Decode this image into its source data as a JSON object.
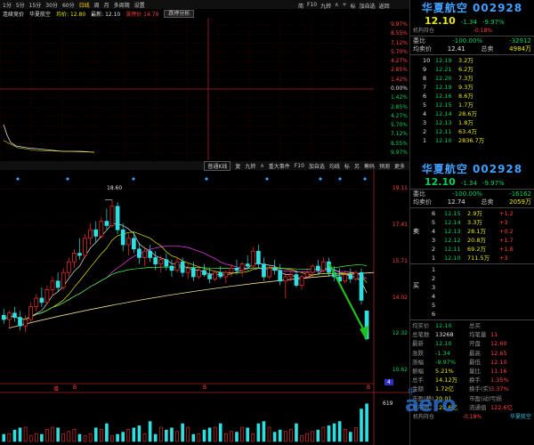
{
  "toolbar": {
    "periods": [
      "1分",
      "5分",
      "15分",
      "30分",
      "60分",
      "日线",
      "周",
      "月",
      "多周期",
      "设置"
    ],
    "active_period": "日线",
    "tools": [
      "简",
      "F10",
      "九转",
      "∧",
      "+",
      "标",
      "加自选",
      "返回"
    ]
  },
  "intraday": {
    "label": "连续竞价",
    "stock_label": "华夏航空",
    "price_label": "均价: 12.80",
    "volume_label": "最新: 12.10",
    "extra_label": "涨停价 14.79",
    "dropdown": "跌停分析",
    "scale_right": [
      "9.97%",
      "8.55%",
      "7.12%",
      "5.70%",
      "4.27%",
      "2.85%",
      "1.42%",
      "0.00%",
      "1.42%",
      "2.85%",
      "4.27%",
      "5.70%",
      "7.12%",
      "8.55%",
      "9.97%"
    ]
  },
  "kline": {
    "toolbar": [
      "普通K线",
      "复",
      "九转",
      "∧",
      "重大事件",
      "F10",
      "加自选",
      "均线",
      "标",
      "另",
      "筹码",
      "预测",
      "更多"
    ],
    "high_label": "18.60",
    "scale_right": [
      "19.11",
      "17.41",
      "15.71",
      "14.02",
      "12.32",
      "10.62"
    ],
    "low_scale": "4",
    "bottom_labels": [
      "增",
      "B",
      "B",
      "B"
    ],
    "volume_scale": [
      "619"
    ]
  },
  "quote_top": {
    "title": "华夏航空 002928",
    "price": "12.10",
    "change": "-1.34",
    "change_pct": "-9.97%",
    "bid_ratio_label": "委比",
    "bid_ratio": "-100.00%",
    "bid_diff": "-32912",
    "avg_label": "均卖价",
    "avg_price": "12.41",
    "total_label": "总卖",
    "total_sell": "4984万",
    "sell_rows": [
      {
        "lvl": "10",
        "price": "12.19",
        "vol": "3.2万"
      },
      {
        "lvl": "9",
        "price": "12.21",
        "vol": "6.2万"
      },
      {
        "lvl": "8",
        "price": "12.20",
        "vol": "7.3万"
      },
      {
        "lvl": "7",
        "price": "12.19",
        "vol": "9.3万"
      },
      {
        "lvl": "6",
        "price": "12.16",
        "vol": "8.6万"
      },
      {
        "lvl": "5",
        "price": "12.15",
        "vol": "1.7万"
      },
      {
        "lvl": "4",
        "price": "12.14",
        "vol": "28.6万"
      },
      {
        "lvl": "3",
        "price": "12.13",
        "vol": "1.8万"
      },
      {
        "lvl": "2",
        "price": "12.11",
        "vol": "63.4万"
      },
      {
        "lvl": "1",
        "price": "12.10",
        "vol": "2836.7万"
      }
    ]
  },
  "quote_main": {
    "title": "华夏航空 002928",
    "price": "12.10",
    "change": "-1.34",
    "change_pct": "-9.97%",
    "bid_ratio_label": "委比",
    "bid_ratio": "-100.00%",
    "bid_diff": "-16162",
    "avg_label": "均卖价",
    "avg_price": "12.74",
    "total_label": "总卖",
    "total_sell": "2059万",
    "sell_side_label": "卖",
    "buy_side_label": "买",
    "sell_rows": [
      {
        "lvl": "6",
        "price": "12.15",
        "vol": "2.9万",
        "tag": "+1.2"
      },
      {
        "lvl": "5",
        "price": "12.14",
        "vol": "3.3万",
        "tag": "+3"
      },
      {
        "lvl": "4",
        "price": "12.13",
        "vol": "28.1万",
        "tag": "+0.2"
      },
      {
        "lvl": "3",
        "price": "12.12",
        "vol": "20.8万",
        "tag": "+1.7"
      },
      {
        "lvl": "2",
        "price": "12.11",
        "vol": "69.2万",
        "tag": "+1.8"
      },
      {
        "lvl": "1",
        "price": "12.10",
        "vol": "711.5万",
        "tag": "+3"
      }
    ],
    "buy_rows": [
      {
        "lvl": "1"
      },
      {
        "lvl": "2"
      },
      {
        "lvl": "3"
      },
      {
        "lvl": "4"
      },
      {
        "lvl": "5"
      },
      {
        "lvl": "6"
      }
    ],
    "stats": [
      {
        "k1": "均买价",
        "v1": "12.10",
        "k2": "总买",
        "v2": ""
      },
      {
        "k1": "总笔数",
        "v1": "13268",
        "k2": "均笔量",
        "v2": "11"
      },
      {
        "k1": "最新",
        "v1": "12.10",
        "k2": "开盘",
        "v2": "12.60"
      },
      {
        "k1": "涨跌",
        "v1": "-1.34",
        "k2": "最高",
        "v2": "12.65"
      },
      {
        "k1": "涨幅",
        "v1": "-9.97%",
        "k2": "最低",
        "v2": "12.10"
      },
      {
        "k1": "振幅",
        "v1": "5.21%",
        "k2": "量比",
        "v2": "11.16"
      },
      {
        "k1": "总手",
        "v1": "14.12万",
        "k2": "换手",
        "v2": "1.35%"
      },
      {
        "k1": "金额",
        "v1": "1.72亿",
        "k2": "换手(实)",
        "v2": "3.37%"
      },
      {
        "k1": "市盈(静)",
        "v1": "20.01",
        "k2": "市盈(动)",
        "v2": "亏损"
      },
      {
        "k1": "总市值",
        "v1": "122.6亿",
        "k2": "流通值",
        "v2": "122.6亿"
      }
    ],
    "footer_label": "机构持仓",
    "footer_pct": "-0.18%",
    "footer_link": "华夏航空"
  },
  "watermark": {
    "text": "aero",
    "sub": "中"
  },
  "chart_data": [
    {
      "type": "candlestick",
      "title": "",
      "xlabel": "",
      "ylabel": "",
      "ylim": [
        10.0,
        19.5
      ],
      "yticks": [
        19.11,
        17.41,
        15.71,
        14.02,
        12.32,
        10.62
      ],
      "high_marker": 18.6,
      "last": 12.1,
      "series": [
        {
          "o": 13.2,
          "h": 13.5,
          "l": 12.8,
          "c": 13.0
        },
        {
          "o": 13.0,
          "h": 13.4,
          "l": 12.6,
          "c": 13.3
        },
        {
          "o": 13.3,
          "h": 13.6,
          "l": 12.9,
          "c": 13.1
        },
        {
          "o": 13.1,
          "h": 13.4,
          "l": 12.5,
          "c": 12.7
        },
        {
          "o": 12.7,
          "h": 13.2,
          "l": 12.4,
          "c": 13.0
        },
        {
          "o": 13.0,
          "h": 13.8,
          "l": 12.9,
          "c": 13.6
        },
        {
          "o": 13.6,
          "h": 14.2,
          "l": 13.4,
          "c": 14.0
        },
        {
          "o": 14.0,
          "h": 14.5,
          "l": 13.6,
          "c": 13.8
        },
        {
          "o": 13.8,
          "h": 14.6,
          "l": 13.7,
          "c": 14.4
        },
        {
          "o": 14.4,
          "h": 15.0,
          "l": 14.1,
          "c": 14.8
        },
        {
          "o": 14.8,
          "h": 15.2,
          "l": 14.3,
          "c": 14.5
        },
        {
          "o": 14.5,
          "h": 15.4,
          "l": 14.4,
          "c": 15.2
        },
        {
          "o": 15.2,
          "h": 15.9,
          "l": 15.0,
          "c": 15.7
        },
        {
          "o": 15.7,
          "h": 16.3,
          "l": 15.4,
          "c": 16.1
        },
        {
          "o": 16.1,
          "h": 16.8,
          "l": 15.8,
          "c": 16.0
        },
        {
          "o": 16.0,
          "h": 17.0,
          "l": 15.9,
          "c": 16.8
        },
        {
          "o": 16.8,
          "h": 17.5,
          "l": 16.5,
          "c": 17.2
        },
        {
          "o": 17.2,
          "h": 17.6,
          "l": 16.6,
          "c": 16.9
        },
        {
          "o": 16.9,
          "h": 17.8,
          "l": 16.8,
          "c": 17.6
        },
        {
          "o": 17.6,
          "h": 18.2,
          "l": 17.2,
          "c": 17.4
        },
        {
          "o": 17.4,
          "h": 18.6,
          "l": 17.3,
          "c": 18.3
        },
        {
          "o": 18.3,
          "h": 18.5,
          "l": 17.0,
          "c": 17.2
        },
        {
          "o": 17.2,
          "h": 17.5,
          "l": 16.2,
          "c": 16.5
        },
        {
          "o": 16.5,
          "h": 17.0,
          "l": 16.0,
          "c": 16.8
        },
        {
          "o": 16.8,
          "h": 17.1,
          "l": 16.1,
          "c": 16.3
        },
        {
          "o": 16.3,
          "h": 16.6,
          "l": 15.6,
          "c": 15.9
        },
        {
          "o": 15.9,
          "h": 16.4,
          "l": 15.5,
          "c": 16.2
        },
        {
          "o": 16.2,
          "h": 16.5,
          "l": 15.7,
          "c": 15.9
        },
        {
          "o": 15.9,
          "h": 16.2,
          "l": 15.3,
          "c": 15.6
        },
        {
          "o": 15.6,
          "h": 16.0,
          "l": 15.2,
          "c": 15.8
        },
        {
          "o": 15.8,
          "h": 16.1,
          "l": 15.3,
          "c": 15.5
        },
        {
          "o": 15.5,
          "h": 15.8,
          "l": 15.0,
          "c": 15.3
        },
        {
          "o": 15.3,
          "h": 15.9,
          "l": 15.2,
          "c": 15.7
        },
        {
          "o": 15.7,
          "h": 15.9,
          "l": 15.0,
          "c": 15.2
        },
        {
          "o": 15.2,
          "h": 15.6,
          "l": 14.9,
          "c": 15.4
        },
        {
          "o": 15.4,
          "h": 15.7,
          "l": 14.8,
          "c": 15.0
        },
        {
          "o": 15.0,
          "h": 15.5,
          "l": 14.9,
          "c": 15.3
        },
        {
          "o": 15.3,
          "h": 15.6,
          "l": 15.0,
          "c": 15.1
        },
        {
          "o": 15.1,
          "h": 15.4,
          "l": 14.7,
          "c": 14.9
        },
        {
          "o": 14.9,
          "h": 15.3,
          "l": 14.8,
          "c": 15.2
        },
        {
          "o": 15.2,
          "h": 15.5,
          "l": 14.9,
          "c": 15.0
        },
        {
          "o": 15.0,
          "h": 15.3,
          "l": 14.7,
          "c": 15.2
        },
        {
          "o": 15.2,
          "h": 15.6,
          "l": 15.0,
          "c": 15.4
        },
        {
          "o": 15.4,
          "h": 15.8,
          "l": 15.1,
          "c": 15.3
        },
        {
          "o": 15.3,
          "h": 15.7,
          "l": 15.0,
          "c": 15.6
        },
        {
          "o": 15.6,
          "h": 16.0,
          "l": 15.3,
          "c": 15.5
        },
        {
          "o": 15.5,
          "h": 16.4,
          "l": 15.4,
          "c": 16.2
        },
        {
          "o": 16.2,
          "h": 16.5,
          "l": 15.4,
          "c": 15.6
        },
        {
          "o": 15.6,
          "h": 15.9,
          "l": 14.8,
          "c": 15.0
        },
        {
          "o": 15.0,
          "h": 15.5,
          "l": 14.9,
          "c": 15.4
        },
        {
          "o": 15.4,
          "h": 15.8,
          "l": 15.1,
          "c": 15.3
        },
        {
          "o": 15.3,
          "h": 15.6,
          "l": 14.6,
          "c": 14.8
        },
        {
          "o": 14.8,
          "h": 15.2,
          "l": 14.0,
          "c": 15.0
        },
        {
          "o": 15.0,
          "h": 15.4,
          "l": 14.8,
          "c": 15.1
        },
        {
          "o": 15.1,
          "h": 15.3,
          "l": 14.5,
          "c": 14.6
        },
        {
          "o": 14.6,
          "h": 15.1,
          "l": 14.4,
          "c": 15.0
        },
        {
          "o": 15.0,
          "h": 15.4,
          "l": 14.9,
          "c": 15.2
        },
        {
          "o": 15.2,
          "h": 15.6,
          "l": 15.0,
          "c": 15.5
        },
        {
          "o": 15.5,
          "h": 15.8,
          "l": 15.1,
          "c": 15.3
        },
        {
          "o": 15.3,
          "h": 15.9,
          "l": 15.2,
          "c": 15.7
        },
        {
          "o": 15.7,
          "h": 15.9,
          "l": 15.0,
          "c": 15.2
        },
        {
          "o": 15.2,
          "h": 15.5,
          "l": 14.8,
          "c": 15.0
        },
        {
          "o": 15.0,
          "h": 15.4,
          "l": 14.6,
          "c": 14.8
        },
        {
          "o": 14.8,
          "h": 15.3,
          "l": 14.7,
          "c": 15.1
        },
        {
          "o": 15.1,
          "h": 15.4,
          "l": 14.7,
          "c": 14.9
        },
        {
          "o": 14.9,
          "h": 15.3,
          "l": 14.8,
          "c": 15.2
        },
        {
          "o": 15.2,
          "h": 15.4,
          "l": 13.7,
          "c": 13.9
        },
        {
          "o": 13.4,
          "h": 13.4,
          "l": 12.1,
          "c": 12.1
        }
      ]
    }
  ]
}
